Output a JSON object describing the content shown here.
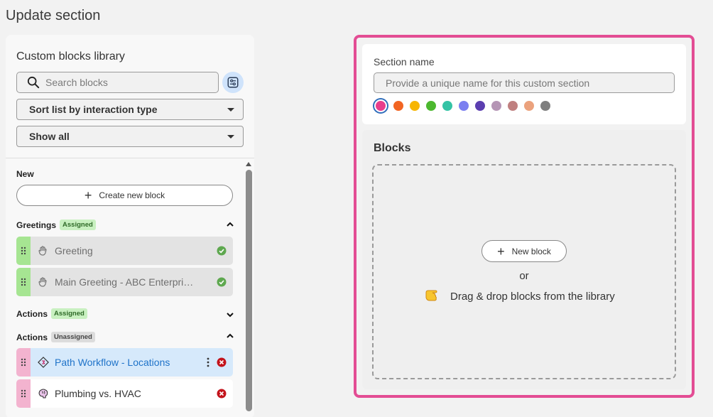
{
  "page": {
    "title": "Update section"
  },
  "library": {
    "title": "Custom blocks library",
    "search_placeholder": "Search blocks",
    "sort_label": "Sort list by interaction type",
    "show_label": "Show all",
    "new_group": "New",
    "create_label": "Create new block",
    "groups": [
      {
        "label": "Greetings",
        "badge": "Assigned",
        "expanded": true,
        "blocks": [
          {
            "label": "Greeting",
            "status": "assigned"
          },
          {
            "label": "Main Greeting - ABC Enterprises",
            "status": "assigned"
          }
        ]
      },
      {
        "label": "Actions",
        "badge": "Assigned",
        "expanded": false,
        "blocks": []
      },
      {
        "label": "Actions",
        "badge": "Unassigned",
        "expanded": true,
        "blocks": [
          {
            "label": "Path Workflow - Locations",
            "status": "unassigned"
          },
          {
            "label": "Plumbing vs. HVAC",
            "status": "unassigned"
          }
        ]
      }
    ]
  },
  "section": {
    "name_label": "Section name",
    "name_placeholder": "Provide a unique name for this custom section",
    "colors": [
      "#e83e8c",
      "#f26522",
      "#f7b500",
      "#4cb82f",
      "#34c3a5",
      "#7b7ff0",
      "#5b3eb0",
      "#b595b5",
      "#c08080",
      "#eba27d",
      "#7f7f7f"
    ],
    "selected_color": "#e83e8c",
    "blocks_title": "Blocks",
    "new_block_label": "New block",
    "or_text": "or",
    "drag_text": "Drag & drop blocks from the library"
  },
  "theme": {
    "accent": "#e34d94",
    "link": "#1f73c9",
    "assigned_green": "#a6e592",
    "unassigned_pink": "#f3b3cf"
  }
}
